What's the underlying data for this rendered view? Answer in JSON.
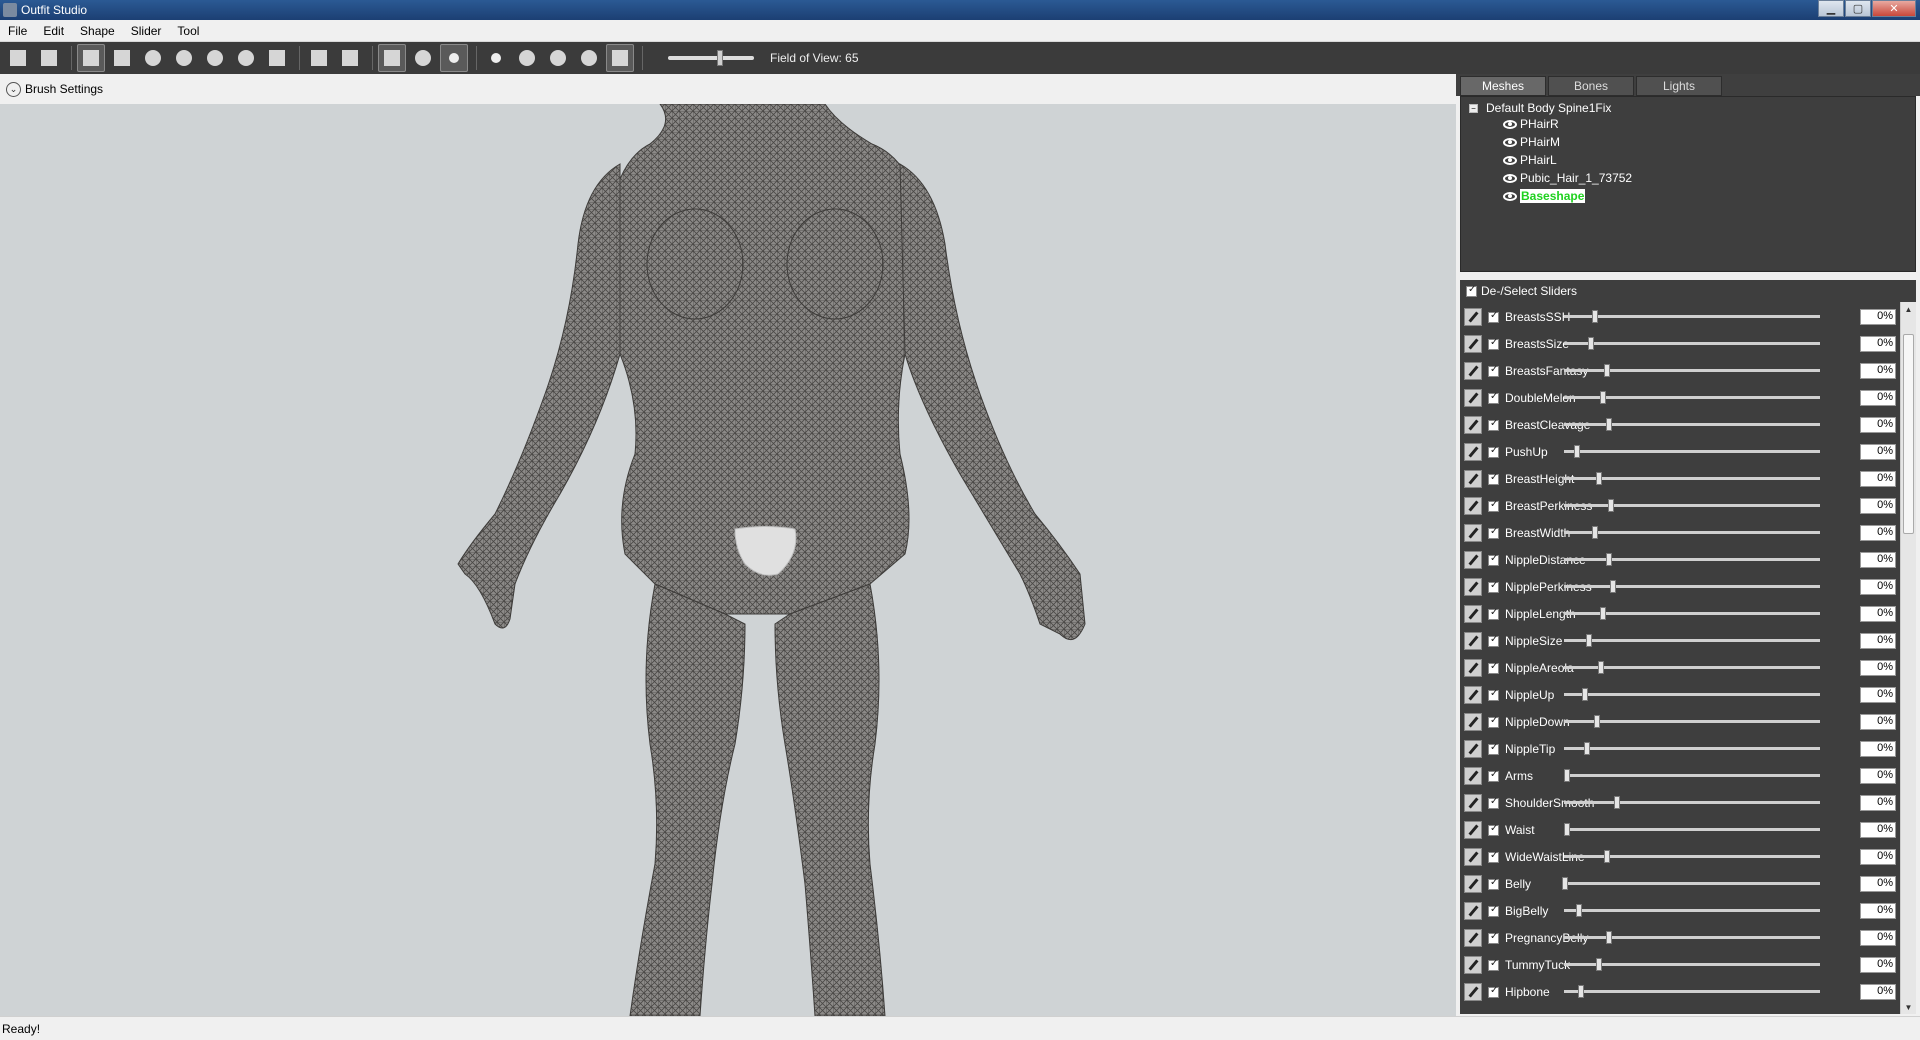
{
  "window": {
    "title": "Outfit Studio"
  },
  "menu": [
    "File",
    "Edit",
    "Shape",
    "Slider",
    "Tool"
  ],
  "toolbar": {
    "fov_label": "Field of View: 65",
    "fov_value": 65
  },
  "brush_settings": {
    "label": "Brush Settings"
  },
  "tabs": [
    "Meshes",
    "Bones",
    "Lights"
  ],
  "mesh_tree": {
    "root": "Default Body Spine1Fix",
    "children": [
      "PHairR",
      "PHairM",
      "PHairL",
      "Pubic_Hair_1_73752",
      "Baseshape"
    ],
    "selected": "Baseshape"
  },
  "slider_panel": {
    "header": "De-/Select Sliders"
  },
  "sliders": [
    {
      "name": "BreastsSSH",
      "value": "0%"
    },
    {
      "name": "BreastsSize",
      "value": "0%"
    },
    {
      "name": "BreastsFantasy",
      "value": "0%"
    },
    {
      "name": "DoubleMelon",
      "value": "0%"
    },
    {
      "name": "BreastCleavage",
      "value": "0%"
    },
    {
      "name": "PushUp",
      "value": "0%"
    },
    {
      "name": "BreastHeight",
      "value": "0%"
    },
    {
      "name": "BreastPerkiness",
      "value": "0%"
    },
    {
      "name": "BreastWidth",
      "value": "0%"
    },
    {
      "name": "NippleDistance",
      "value": "0%"
    },
    {
      "name": "NipplePerkiness",
      "value": "0%"
    },
    {
      "name": "NippleLength",
      "value": "0%"
    },
    {
      "name": "NippleSize",
      "value": "0%"
    },
    {
      "name": "NippleAreola",
      "value": "0%"
    },
    {
      "name": "NippleUp",
      "value": "0%"
    },
    {
      "name": "NippleDown",
      "value": "0%"
    },
    {
      "name": "NippleTip",
      "value": "0%"
    },
    {
      "name": "Arms",
      "value": "0%"
    },
    {
      "name": "ShoulderSmooth",
      "value": "0%"
    },
    {
      "name": "Waist",
      "value": "0%"
    },
    {
      "name": "WideWaistLine",
      "value": "0%"
    },
    {
      "name": "Belly",
      "value": "0%"
    },
    {
      "name": "BigBelly",
      "value": "0%"
    },
    {
      "name": "PregnancyBelly",
      "value": "0%"
    },
    {
      "name": "TummyTuck",
      "value": "0%"
    },
    {
      "name": "Hipbone",
      "value": "0%"
    }
  ],
  "status": {
    "text": "Ready!"
  }
}
